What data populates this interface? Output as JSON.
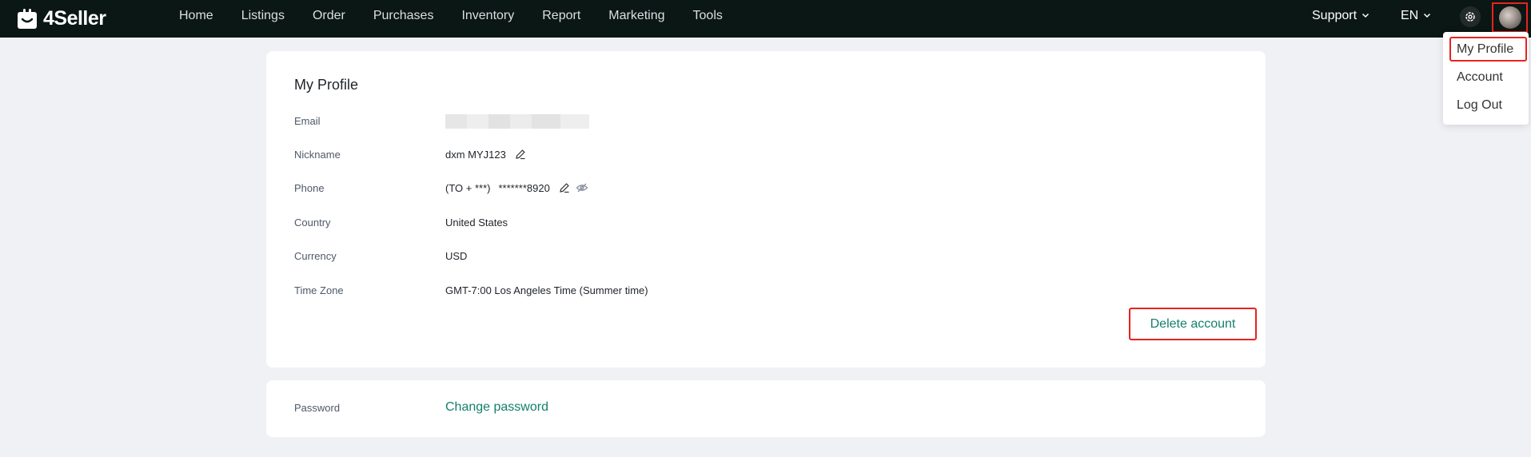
{
  "app": {
    "logo_text": "4Seller",
    "brand_color": "#13806c"
  },
  "nav": {
    "items": [
      "Home",
      "Listings",
      "Order",
      "Purchases",
      "Inventory",
      "Report",
      "Marketing",
      "Tools"
    ]
  },
  "header": {
    "support_label": "Support",
    "language_label": "EN"
  },
  "user_menu": {
    "items": [
      "My Profile",
      "Account",
      "Log Out"
    ]
  },
  "profile": {
    "title": "My Profile",
    "email_label": "Email",
    "nickname_label": "Nickname",
    "nickname_value": "dxm MYJ123",
    "phone_label": "Phone",
    "phone_prefix": "(TO + ***)",
    "phone_value": "*******8920",
    "country_label": "Country",
    "country_value": "United States",
    "currency_label": "Currency",
    "currency_value": "USD",
    "timezone_label": "Time Zone",
    "timezone_value": "GMT-7:00 Los Angeles Time (Summer time)",
    "delete_label": "Delete account"
  },
  "password": {
    "label": "Password",
    "change_label": "Change password"
  }
}
